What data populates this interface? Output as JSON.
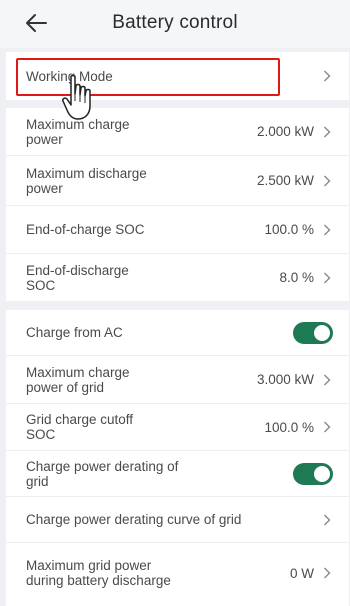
{
  "header": {
    "title": "Battery control",
    "back_icon": "arrow-left-icon"
  },
  "section1": {
    "working_mode": {
      "label": "Working Mode"
    }
  },
  "section2": [
    {
      "label": "Maximum charge power",
      "value": "2.000 kW"
    },
    {
      "label": "Maximum discharge power",
      "value": "2.500 kW"
    },
    {
      "label": "End-of-charge SOC",
      "value": "100.0 %"
    },
    {
      "label": "End-of-discharge SOC",
      "value": "8.0 %"
    }
  ],
  "section3": {
    "charge_from_ac": {
      "label": "Charge from AC",
      "enabled": true
    },
    "max_charge_power_grid": {
      "label": "Maximum charge power of grid",
      "value": "3.000 kW"
    },
    "grid_charge_cutoff": {
      "label": "Grid charge cutoff SOC",
      "value": "100.0 %"
    },
    "charge_power_derating": {
      "label": "Charge power derating of grid",
      "enabled": true
    },
    "derating_curve": {
      "label": "Charge power derating curve of grid"
    },
    "max_grid_power_discharge": {
      "label": "Maximum grid power during battery discharge",
      "value": "0 W"
    }
  },
  "colors": {
    "toggle_on": "#1e7a53",
    "highlight": "#e01818",
    "background": "#eef0f3"
  }
}
